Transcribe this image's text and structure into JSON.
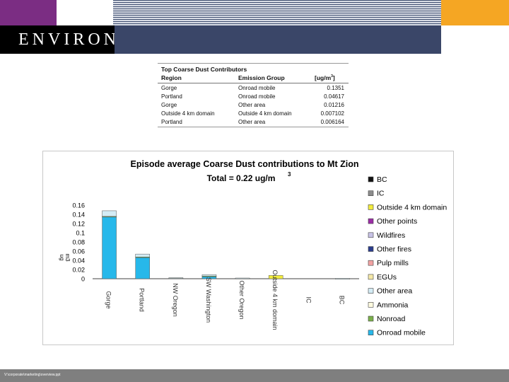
{
  "header": {
    "logo_text": "ENVIRON",
    "colors": {
      "purple": "#7b2d83",
      "orange": "#f5a623",
      "navy": "#3a4668"
    }
  },
  "table": {
    "title": "Top Coarse Dust Contributors",
    "headers": [
      "Region",
      "Emission Group",
      "[ug/m3]"
    ],
    "rows": [
      [
        "Gorge",
        "Onroad mobile",
        "0.1351"
      ],
      [
        "Portland",
        "Onroad mobile",
        "0.04617"
      ],
      [
        "Gorge",
        "Other area",
        "0.01216"
      ],
      [
        "Outside 4 km domain",
        "Outside 4 km domain",
        "0.007102"
      ],
      [
        "Portland",
        "Other area",
        "0.006164"
      ]
    ]
  },
  "chart_data": {
    "type": "bar",
    "stacked": true,
    "title": "Episode average Coarse Dust contributions to Mt Zion",
    "subtitle": "Total = 0.22 ug/m3",
    "ylabel": "ug/m3",
    "ylim": [
      0,
      0.16
    ],
    "yticks": [
      0,
      0.02,
      0.04,
      0.06,
      0.08,
      0.1,
      0.12,
      0.14,
      0.16
    ],
    "categories": [
      "Gorge",
      "Portland",
      "NW Oregon",
      "SW Washington",
      "Other Oregon",
      "Outside 4 km domain",
      "IC",
      "BC"
    ],
    "legend_position": "right",
    "series": [
      {
        "name": "BC",
        "color": "#111111",
        "values": [
          0,
          0,
          0,
          0,
          0,
          0,
          0,
          0
        ]
      },
      {
        "name": "IC",
        "color": "#8c8c8c",
        "values": [
          0,
          0,
          0,
          0,
          0,
          0,
          0,
          0
        ]
      },
      {
        "name": "Outside 4 km domain",
        "color": "#f2ec3d",
        "values": [
          0,
          0,
          0,
          0,
          0,
          0.0071,
          0,
          0
        ]
      },
      {
        "name": "Other points",
        "color": "#9b2ca6",
        "values": [
          0,
          0,
          0,
          0,
          0,
          0,
          0,
          0
        ]
      },
      {
        "name": "Wildfires",
        "color": "#c7c2e6",
        "values": [
          0,
          0,
          0,
          0,
          0,
          0,
          0,
          0
        ]
      },
      {
        "name": "Other fires",
        "color": "#2b3d8c",
        "values": [
          0,
          0,
          0,
          0,
          0,
          0,
          0,
          0
        ]
      },
      {
        "name": "Pulp mills",
        "color": "#f2a3a3",
        "values": [
          0,
          0,
          0,
          0,
          0,
          0,
          0,
          0
        ]
      },
      {
        "name": "EGUs",
        "color": "#f5e9a8",
        "values": [
          0,
          0,
          0,
          0,
          0,
          0,
          0,
          0
        ]
      },
      {
        "name": "Other area",
        "color": "#d4ecf5",
        "values": [
          0.0122,
          0.0062,
          0.0005,
          0.003,
          0.0003,
          0,
          0,
          0.0002
        ]
      },
      {
        "name": "Ammonia",
        "color": "#fffbe0",
        "values": [
          0,
          0,
          0,
          0,
          0,
          0,
          0,
          0
        ]
      },
      {
        "name": "Nonroad",
        "color": "#7ab04a",
        "values": [
          0.0005,
          0.0012,
          0.0002,
          0.0008,
          0.0002,
          0,
          0,
          0
        ]
      },
      {
        "name": "Onroad mobile",
        "color": "#27b8ea",
        "values": [
          0.1351,
          0.0462,
          0.0015,
          0.005,
          0.001,
          0,
          0,
          0.0005
        ]
      }
    ]
  },
  "footer": {
    "path": "V:\\corporate\\marketing\\overview.ppt"
  }
}
